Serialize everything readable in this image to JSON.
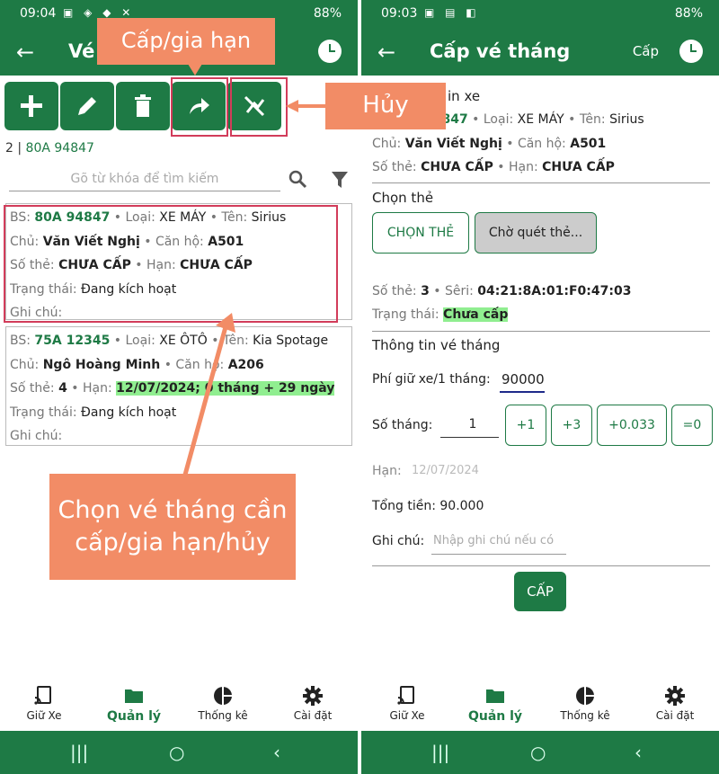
{
  "left": {
    "status": {
      "time": "09:04",
      "battery": "88%"
    },
    "appbar": {
      "title": "Vé"
    },
    "selection": {
      "count": "2 |",
      "plate": "80A 94847"
    },
    "search_placeholder": "Gõ từ khóa để tìm kiếm",
    "cards": [
      {
        "bs_label": "BS:",
        "bs": "80A 94847",
        "type_label": "• Loại:",
        "type": "XE MÁY",
        "name_label": "• Tên:",
        "name": "Sirius",
        "owner_label": "Chủ:",
        "owner": "Văn Viết Nghị",
        "apt_label": "• Căn hộ:",
        "apt": "A501",
        "card_label": "Số thẻ:",
        "card": "CHƯA CẤP",
        "exp_label": "• Hạn:",
        "exp": "CHƯA CẤP",
        "state_label": "Trạng thái:",
        "state": "Đang kích hoạt",
        "note_label": "Ghi chú:"
      },
      {
        "bs_label": "BS:",
        "bs": "75A 12345",
        "type_label": "• Loại:",
        "type": "XE ÔTÔ",
        "name_label": "• Tên:",
        "name": "Kia Spotage",
        "owner_label": "Chủ:",
        "owner": "Ngô Hoàng Minh",
        "apt_label": "• Căn hộ:",
        "apt": "A206",
        "card_label": "Số thẻ:",
        "card": "4",
        "exp_label": "• Hạn:",
        "exp": "12/07/2024; 0 tháng + 29 ngày",
        "state_label": "Trạng thái:",
        "state": "Đang kích hoạt",
        "note_label": "Ghi chú:"
      }
    ],
    "callouts": {
      "issue": "Cấp/gia hạn",
      "cancel": "Hủy",
      "choose_line1": "Chọn vé tháng cần",
      "choose_line2": "cấp/gia hạn/hủy"
    }
  },
  "nav": {
    "items": [
      {
        "label": "Giữ Xe"
      },
      {
        "label": "Quản lý"
      },
      {
        "label": "Thống kê"
      },
      {
        "label": "Cài đặt"
      }
    ]
  },
  "right": {
    "status": {
      "time": "09:03",
      "battery": "88%"
    },
    "appbar": {
      "title": "Cấp vé tháng",
      "action": "Cấp"
    },
    "info_header": "in xe",
    "plate": "94847",
    "type_label": "• Loại:",
    "type": "XE MÁY",
    "name_label": "• Tên:",
    "name": "Sirius",
    "owner_label": "Chủ:",
    "owner": "Văn Viết Nghị",
    "apt_label": "• Căn hộ:",
    "apt": "A501",
    "card_label": "Số thẻ:",
    "card": "CHƯA CẤP",
    "exp_label": "• Hạn:",
    "exp": "CHƯA CẤP",
    "choose_card_title": "Chọn thẻ",
    "choose_card_btn": "CHỌN THẺ",
    "waiting_btn": "Chờ quét thẻ...",
    "card_no_label": "Số thẻ:",
    "card_no": "3",
    "serial_label": "• Sêri:",
    "serial": "04:21:8A:01:F0:47:03",
    "card_state_label": "Trạng thái:",
    "card_state": "Chưa cấp",
    "ticket_title": "Thông tin vé tháng",
    "fee_label": "Phí giữ xe/1 tháng:",
    "fee": "90000",
    "months_label": "Số tháng:",
    "months": "1",
    "inc_buttons": [
      "+1",
      "+3",
      "+0.033",
      "=0"
    ],
    "deadline_label": "Hạn:",
    "deadline": "12/07/2024",
    "total_label": "Tổng tiền:",
    "total": "90.000",
    "note_label": "Ghi chú:",
    "note_placeholder": "Nhập ghi chú nếu có",
    "submit": "CẤP"
  },
  "colors": {
    "primary": "#1e7a45",
    "callout": "#f28c66",
    "highlight": "#d23c5a",
    "ok": "#90ee90"
  }
}
